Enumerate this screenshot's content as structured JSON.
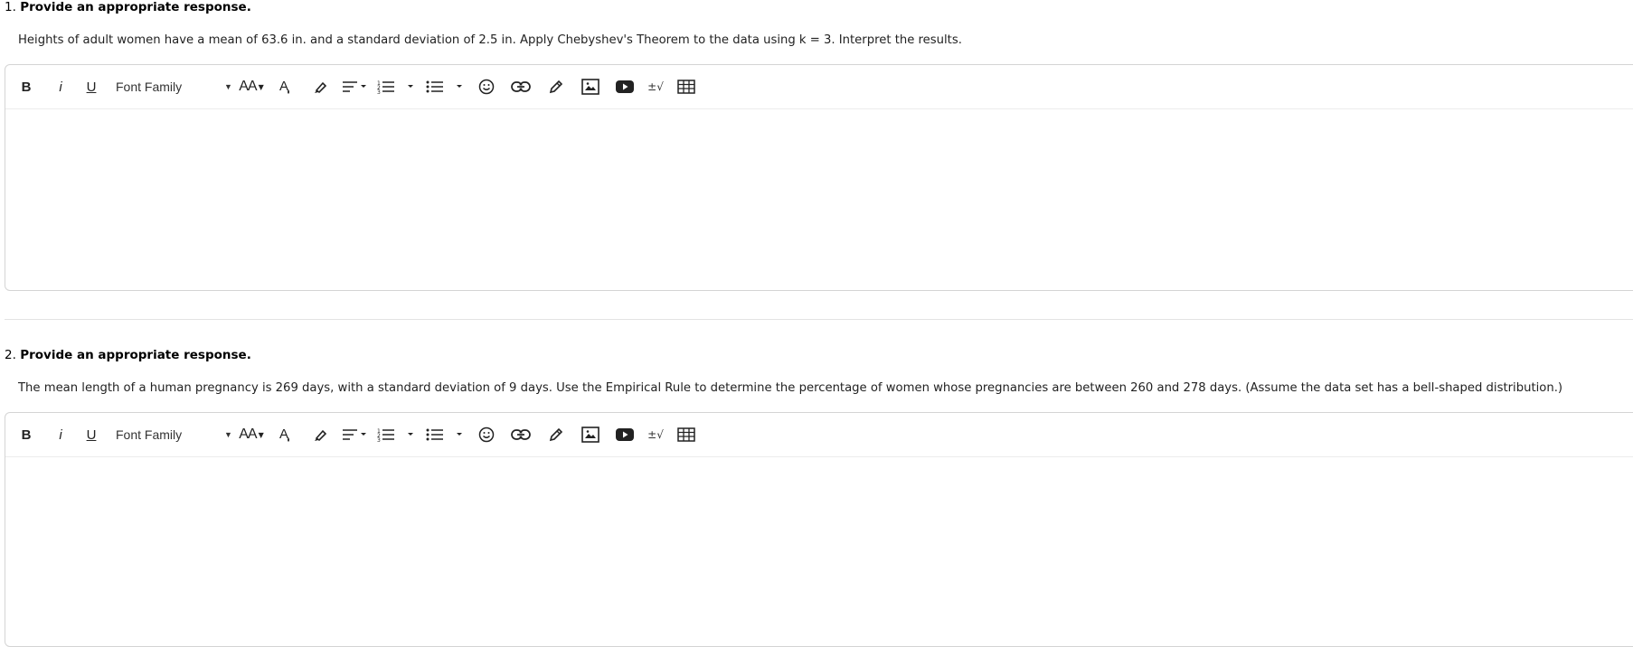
{
  "questions": [
    {
      "number": "1.",
      "title": "Provide an appropriate response.",
      "text": "Heights of adult women have a mean of 63.6 in. and a standard deviation of 2.5 in. Apply Chebyshev's Theorem to the data using k = 3. Interpret the results.",
      "answer_value": ""
    },
    {
      "number": "2.",
      "title": "Provide an appropriate response.",
      "text": "The mean length of a human pregnancy is 269 days, with a standard deviation of 9 days. Use the Empirical Rule to determine the percentage of women whose pregnancies are between 260 and 278 days. (Assume the data set has a bell-shaped distribution.)",
      "answer_value": ""
    }
  ],
  "toolbar": {
    "bold_label": "B",
    "italic_label": "i",
    "underline_label": "U",
    "font_family_label": "Font Family",
    "font_size_label": "AA",
    "math_label": "±√"
  },
  "icons": [
    "bold-icon",
    "italic-icon",
    "underline-icon",
    "font-family-dropdown",
    "font-size-icon",
    "text-color-icon",
    "highlight-icon",
    "align-icon",
    "ordered-list-icon",
    "unordered-list-icon",
    "emoji-icon",
    "link-icon",
    "draw-icon",
    "image-icon",
    "video-icon",
    "math-icon",
    "table-icon"
  ]
}
